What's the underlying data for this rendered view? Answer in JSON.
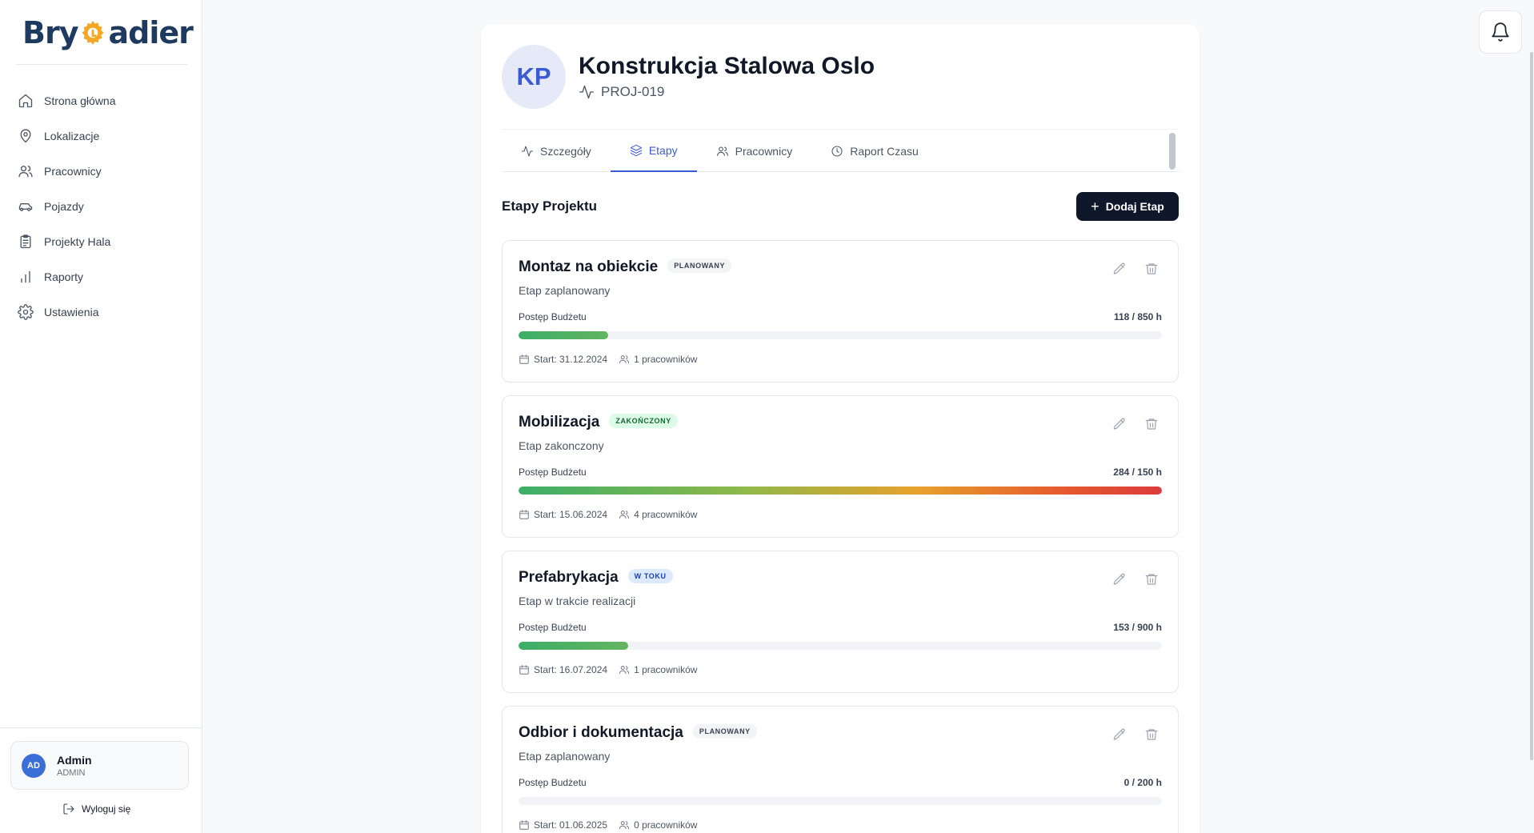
{
  "brand": {
    "logo_text_1": "Bry",
    "logo_text_2": "adier"
  },
  "sidebar": {
    "items": [
      {
        "label": "Strona główna",
        "icon": "home-icon"
      },
      {
        "label": "Lokalizacje",
        "icon": "map-pin-icon"
      },
      {
        "label": "Pracownicy",
        "icon": "users-icon"
      },
      {
        "label": "Pojazdy",
        "icon": "car-icon"
      },
      {
        "label": "Projekty Hala",
        "icon": "clipboard-icon"
      },
      {
        "label": "Raporty",
        "icon": "bar-chart-icon"
      },
      {
        "label": "Ustawienia",
        "icon": "gear-icon"
      }
    ],
    "user": {
      "initials": "AD",
      "name": "Admin",
      "role": "ADMIN"
    },
    "logout_label": "Wyloguj się"
  },
  "project": {
    "initials": "KP",
    "title": "Konstrukcja Stalowa Oslo",
    "code": "PROJ-019"
  },
  "tabs": [
    {
      "label": "Szczegóły",
      "active": false
    },
    {
      "label": "Etapy",
      "active": true
    },
    {
      "label": "Pracownicy",
      "active": false
    },
    {
      "label": "Raport Czasu",
      "active": false
    }
  ],
  "stages_section": {
    "title": "Etapy Projektu",
    "add_label": "Dodaj Etap",
    "budget_label": "Postęp Budżetu"
  },
  "colors": {
    "primary": "#3b5bd6",
    "dark_button": "#0f172a",
    "progress_green": "#3cae68",
    "progress_red": "#dc3c3c"
  },
  "stages": [
    {
      "name": "Montaz na obiekcie",
      "status": "PLANOWANY",
      "status_kind": "planned",
      "description": "Etap zaplanowany",
      "budget": "118 / 850 h",
      "progress": 0.139,
      "start": "Start: 31.12.2024",
      "workers": "1 pracowników"
    },
    {
      "name": "Mobilizacja",
      "status": "ZAKOŃCZONY",
      "status_kind": "done",
      "description": "Etap zakonczony",
      "budget": "284 / 150 h",
      "progress": 1.0,
      "start": "Start: 15.06.2024",
      "workers": "4 pracowników"
    },
    {
      "name": "Prefabrykacja",
      "status": "W TOKU",
      "status_kind": "progress",
      "description": "Etap w trakcie realizacji",
      "budget": "153 / 900 h",
      "progress": 0.17,
      "start": "Start: 16.07.2024",
      "workers": "1 pracowników"
    },
    {
      "name": "Odbior i dokumentacja",
      "status": "PLANOWANY",
      "status_kind": "planned",
      "description": "Etap zaplanowany",
      "budget": "0 / 200 h",
      "progress": 0.0,
      "start": "Start: 01.06.2025",
      "workers": "0 pracowników"
    }
  ]
}
